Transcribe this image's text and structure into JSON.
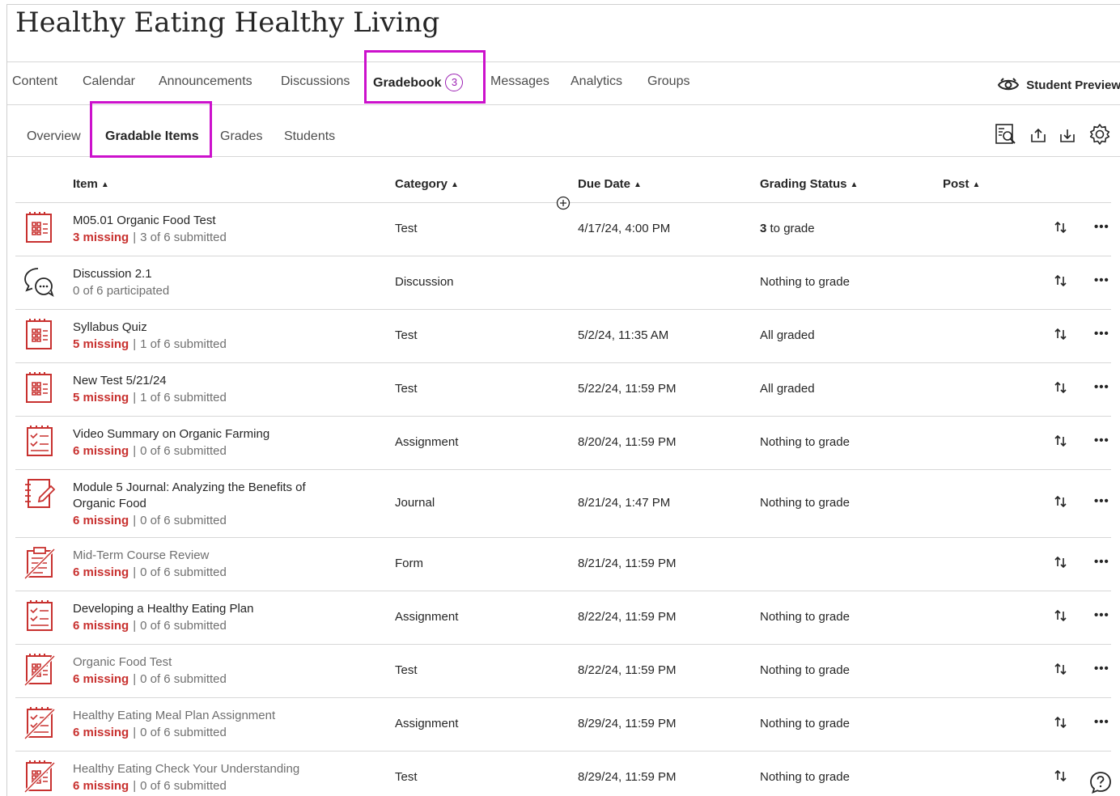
{
  "course": {
    "title": "Healthy Eating Healthy Living"
  },
  "topnav": {
    "tabs": [
      {
        "label": "Content"
      },
      {
        "label": "Calendar"
      },
      {
        "label": "Announcements"
      },
      {
        "label": "Discussions"
      },
      {
        "label": "Gradebook",
        "badge": "3",
        "active": true
      },
      {
        "label": "Messages"
      },
      {
        "label": "Analytics"
      },
      {
        "label": "Groups"
      }
    ],
    "student_preview": "Student Preview"
  },
  "subnav": {
    "tabs": [
      {
        "label": "Overview"
      },
      {
        "label": "Gradable Items",
        "active": true
      },
      {
        "label": "Grades"
      },
      {
        "label": "Students"
      }
    ],
    "tools": [
      "grade-search-icon",
      "upload-icon",
      "download-icon",
      "settings-gear-icon"
    ]
  },
  "table": {
    "headers": {
      "item": "Item",
      "category": "Category",
      "due": "Due Date",
      "status": "Grading Status",
      "post": "Post"
    },
    "rows": [
      {
        "icon": "test-icon",
        "title": "M05.01 Organic Food Test",
        "missing": "3 missing",
        "submitted": "3 of 6 submitted",
        "category": "Test",
        "due": "4/17/24, 4:00 PM",
        "status_bold": "3",
        "status": " to grade",
        "dim": false
      },
      {
        "icon": "discussion-icon",
        "title": "Discussion 2.1",
        "missing": "",
        "submitted": "0 of 6 participated",
        "category": "Discussion",
        "due": "",
        "status_bold": "",
        "status": "Nothing to grade",
        "dim": false
      },
      {
        "icon": "test-icon",
        "title": "Syllabus Quiz",
        "missing": "5 missing",
        "submitted": "1 of 6 submitted",
        "category": "Test",
        "due": "5/2/24, 11:35 AM",
        "status_bold": "",
        "status": "All graded",
        "dim": false
      },
      {
        "icon": "test-icon",
        "title": "New Test 5/21/24",
        "missing": "5 missing",
        "submitted": "1 of 6 submitted",
        "category": "Test",
        "due": "5/22/24, 11:59 PM",
        "status_bold": "",
        "status": "All graded",
        "dim": false
      },
      {
        "icon": "assignment-icon",
        "title": "Video Summary on Organic Farming",
        "missing": "6 missing",
        "submitted": "0 of 6 submitted",
        "category": "Assignment",
        "due": "8/20/24, 11:59 PM",
        "status_bold": "",
        "status": "Nothing to grade",
        "dim": false
      },
      {
        "icon": "journal-icon",
        "title": "Module 5 Journal: Analyzing the Benefits of",
        "title2": "Organic Food",
        "missing": "6 missing",
        "submitted": "0 of 6 submitted",
        "category": "Journal",
        "due": "8/21/24, 1:47 PM",
        "status_bold": "",
        "status": "Nothing to grade",
        "dim": false
      },
      {
        "icon": "form-hidden-icon",
        "title": "Mid-Term Course Review",
        "missing": "6 missing",
        "submitted": "0 of 6 submitted",
        "category": "Form",
        "due": "8/21/24, 11:59 PM",
        "status_bold": "",
        "status": "",
        "dim": true
      },
      {
        "icon": "assignment-icon",
        "title": "Developing a Healthy Eating Plan",
        "missing": "6 missing",
        "submitted": "0 of 6 submitted",
        "category": "Assignment",
        "due": "8/22/24, 11:59 PM",
        "status_bold": "",
        "status": "Nothing to grade",
        "dim": false
      },
      {
        "icon": "test-hidden-icon",
        "title": "Organic Food Test",
        "missing": "6 missing",
        "submitted": "0 of 6 submitted",
        "category": "Test",
        "due": "8/22/24, 11:59 PM",
        "status_bold": "",
        "status": "Nothing to grade",
        "dim": true
      },
      {
        "icon": "assignment-hidden-icon",
        "title": "Healthy Eating Meal Plan Assignment",
        "missing": "6 missing",
        "submitted": "0 of 6 submitted",
        "category": "Assignment",
        "due": "8/29/24, 11:59 PM",
        "status_bold": "",
        "status": "Nothing to grade",
        "dim": true
      },
      {
        "icon": "test-hidden-icon",
        "title": "Healthy Eating Check Your Understanding",
        "missing": "6 missing",
        "submitted": "0 of 6 submitted",
        "category": "Test",
        "due": "8/29/24, 11:59 PM",
        "status_bold": "",
        "status": "Nothing to grade",
        "dim": true
      }
    ],
    "more_label": "•••"
  },
  "colors": {
    "accent_red": "#c8312f",
    "highlight": "#cc11cc",
    "badge": "#9c1fb3"
  }
}
